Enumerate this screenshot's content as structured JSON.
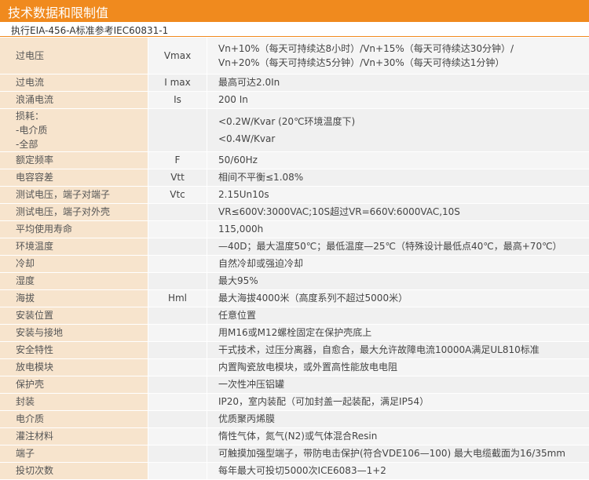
{
  "title": "技术数据和限制值",
  "subtitle": "执行EIA-456-A标准参考IEC60831-1",
  "rows": [
    {
      "name": "过电压",
      "symbol": "Vmax",
      "value": "Vn+10%（每天可持续达8小时）/Vn+15%（每天可待续达30分钟）/ Vn+20%（每天可持续达5分钟）/Vn+30%（每天可待续达1分钟）"
    },
    {
      "name": "过电流",
      "symbol": "I max",
      "value": "最高可达2.0In"
    },
    {
      "name": "浪涌电流",
      "symbol": "Is",
      "value": "200 In"
    },
    {
      "name": "损耗：\n-电介质\n-全部",
      "symbol": "",
      "value": "<0.2W/Kvar (20℃环境温度下)\n<0.4W/Kvar"
    },
    {
      "name": "额定频率",
      "symbol": "F",
      "value": "50/60Hz"
    },
    {
      "name": "电容容差",
      "symbol": "Vtt",
      "value": "相间不平衡≤1.08%"
    },
    {
      "name": "测试电压，端子对端子",
      "symbol": "Vtc",
      "value": "2.15Un10s"
    },
    {
      "name": "测试电压，端子对外壳",
      "symbol": "",
      "value": "VR≤600V:3000VAC;10S超过VR=660V:6000VAC,10S"
    },
    {
      "name": "平均使用寿命",
      "symbol": "",
      "value": "115,000h"
    },
    {
      "name": "环境温度",
      "symbol": "",
      "value": "—40D；最大温度50℃；最低温度—25℃（特殊设计最低点40℃，最高+70℃）"
    },
    {
      "name": "冷却",
      "symbol": "",
      "value": "自然冷却或强迫冷却"
    },
    {
      "name": "湿度",
      "symbol": "",
      "value": "最大95%"
    },
    {
      "name": "海拔",
      "symbol": "Hml",
      "value": "最大海拔4000米（高度系列不超过5000米）"
    },
    {
      "name": "安装位置",
      "symbol": "",
      "value": "任意位置"
    },
    {
      "name": "安装与接地",
      "symbol": "",
      "value": "用M16或M12螺栓固定在保护壳底上"
    },
    {
      "name": "安全特性",
      "symbol": "",
      "value": "干式技术，过压分离器，自愈合，最大允许故障电流10000A满足UL810标准"
    },
    {
      "name": "放电模块",
      "symbol": "",
      "value": "内置陶瓷放电模块，或外置高性能放电电阻"
    },
    {
      "name": "保护壳",
      "symbol": "",
      "value": "一次性冲压铝罐"
    },
    {
      "name": "封装",
      "symbol": "",
      "value": "IP20，室内装配（可加封盖一起装配，满足IP54）"
    },
    {
      "name": "电介质",
      "symbol": "",
      "value": "优质聚丙烯膜"
    },
    {
      "name": "灌注材料",
      "symbol": "",
      "value": "惰性气体，氮气(N2)或气体混合Resin"
    },
    {
      "name": "端子",
      "symbol": "",
      "value": "可触摸加强型端子，带防电击保护(符合VDE106—100) 最大电缆截面为16/35mm"
    },
    {
      "name": "投切次数",
      "symbol": "",
      "value": "每年最大可投切5000次ICE6083—1+2"
    }
  ]
}
